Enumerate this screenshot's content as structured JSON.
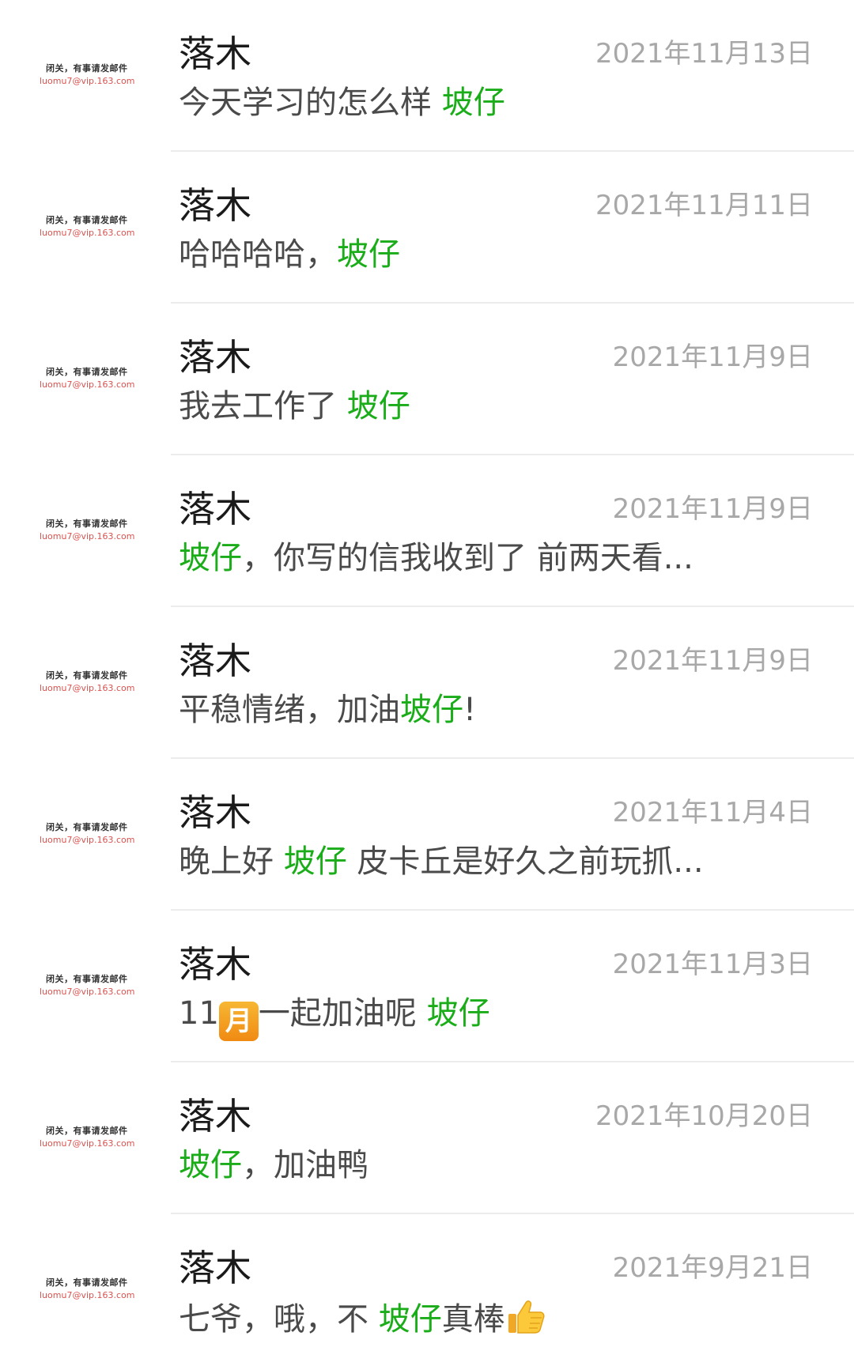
{
  "avatar": {
    "line1": "闭关，有事请发邮件",
    "line2": "luomu7@vip.163.com"
  },
  "messages": [
    {
      "name": "落木",
      "date": "2021年11月13日",
      "pre": "今天学习的怎么样 ",
      "hl": "坡仔",
      "post": ""
    },
    {
      "name": "落木",
      "date": "2021年11月11日",
      "pre": "哈哈哈哈，",
      "hl": "坡仔",
      "post": ""
    },
    {
      "name": "落木",
      "date": "2021年11月9日",
      "pre": "我去工作了 ",
      "hl": "坡仔",
      "post": ""
    },
    {
      "name": "落木",
      "date": "2021年11月9日",
      "pre": "",
      "hl": "坡仔",
      "post": "，你写的信我收到了  前两天看..."
    },
    {
      "name": "落木",
      "date": "2021年11月9日",
      "pre": "平稳情绪，加油",
      "hl": "坡仔",
      "post": "!"
    },
    {
      "name": "落木",
      "date": "2021年11月4日",
      "pre": "晚上好 ",
      "hl": "坡仔",
      "post": "  皮卡丘是好久之前玩抓..."
    },
    {
      "name": "落木",
      "date": "2021年11月3日",
      "pre": "11",
      "emoji": "月",
      "pre2": "一起加油呢 ",
      "hl": "坡仔",
      "post": ""
    },
    {
      "name": "落木",
      "date": "2021年10月20日",
      "pre": "",
      "hl": "坡仔",
      "post": "，加油鸭"
    },
    {
      "name": "落木",
      "date": "2021年9月21日",
      "pre": "七爷，哦，不 ",
      "hl": "坡仔",
      "post": "真棒",
      "emoji_icon": "thumbs-up-icon"
    }
  ]
}
